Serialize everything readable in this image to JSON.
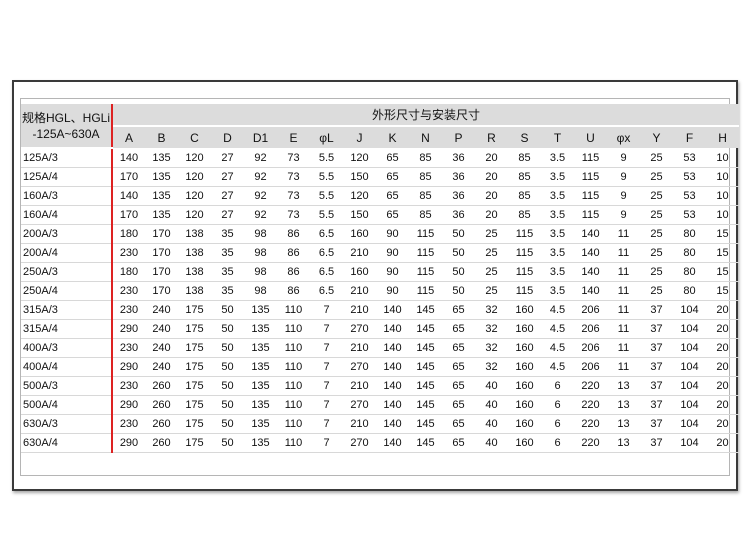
{
  "table": {
    "spec_header_line1": "规格HGL、HGLi",
    "spec_header_line2": "-125A~630A",
    "group_header": "外形尺寸与安装尺寸",
    "columns": [
      "A",
      "B",
      "C",
      "D",
      "D1",
      "E",
      "φL",
      "J",
      "K",
      "N",
      "P",
      "R",
      "S",
      "T",
      "U",
      "φx",
      "Y",
      "F",
      "H"
    ],
    "rows": [
      {
        "spec": "125A/3",
        "values": [
          "140",
          "135",
          "120",
          "27",
          "92",
          "73",
          "5.5",
          "120",
          "65",
          "85",
          "36",
          "20",
          "85",
          "3.5",
          "115",
          "9",
          "25",
          "53",
          "10"
        ]
      },
      {
        "spec": "125A/4",
        "values": [
          "170",
          "135",
          "120",
          "27",
          "92",
          "73",
          "5.5",
          "150",
          "65",
          "85",
          "36",
          "20",
          "85",
          "3.5",
          "115",
          "9",
          "25",
          "53",
          "10"
        ]
      },
      {
        "spec": "160A/3",
        "values": [
          "140",
          "135",
          "120",
          "27",
          "92",
          "73",
          "5.5",
          "120",
          "65",
          "85",
          "36",
          "20",
          "85",
          "3.5",
          "115",
          "9",
          "25",
          "53",
          "10"
        ]
      },
      {
        "spec": "160A/4",
        "values": [
          "170",
          "135",
          "120",
          "27",
          "92",
          "73",
          "5.5",
          "150",
          "65",
          "85",
          "36",
          "20",
          "85",
          "3.5",
          "115",
          "9",
          "25",
          "53",
          "10"
        ]
      },
      {
        "spec": "200A/3",
        "values": [
          "180",
          "170",
          "138",
          "35",
          "98",
          "86",
          "6.5",
          "160",
          "90",
          "115",
          "50",
          "25",
          "115",
          "3.5",
          "140",
          "11",
          "25",
          "80",
          "15"
        ]
      },
      {
        "spec": "200A/4",
        "values": [
          "230",
          "170",
          "138",
          "35",
          "98",
          "86",
          "6.5",
          "210",
          "90",
          "115",
          "50",
          "25",
          "115",
          "3.5",
          "140",
          "11",
          "25",
          "80",
          "15"
        ]
      },
      {
        "spec": "250A/3",
        "values": [
          "180",
          "170",
          "138",
          "35",
          "98",
          "86",
          "6.5",
          "160",
          "90",
          "115",
          "50",
          "25",
          "115",
          "3.5",
          "140",
          "11",
          "25",
          "80",
          "15"
        ]
      },
      {
        "spec": "250A/4",
        "values": [
          "230",
          "170",
          "138",
          "35",
          "98",
          "86",
          "6.5",
          "210",
          "90",
          "115",
          "50",
          "25",
          "115",
          "3.5",
          "140",
          "11",
          "25",
          "80",
          "15"
        ]
      },
      {
        "spec": "315A/3",
        "values": [
          "230",
          "240",
          "175",
          "50",
          "135",
          "110",
          "7",
          "210",
          "140",
          "145",
          "65",
          "32",
          "160",
          "4.5",
          "206",
          "11",
          "37",
          "104",
          "20"
        ]
      },
      {
        "spec": "315A/4",
        "values": [
          "290",
          "240",
          "175",
          "50",
          "135",
          "110",
          "7",
          "270",
          "140",
          "145",
          "65",
          "32",
          "160",
          "4.5",
          "206",
          "11",
          "37",
          "104",
          "20"
        ]
      },
      {
        "spec": "400A/3",
        "values": [
          "230",
          "240",
          "175",
          "50",
          "135",
          "110",
          "7",
          "210",
          "140",
          "145",
          "65",
          "32",
          "160",
          "4.5",
          "206",
          "11",
          "37",
          "104",
          "20"
        ]
      },
      {
        "spec": "400A/4",
        "values": [
          "290",
          "240",
          "175",
          "50",
          "135",
          "110",
          "7",
          "270",
          "140",
          "145",
          "65",
          "32",
          "160",
          "4.5",
          "206",
          "11",
          "37",
          "104",
          "20"
        ]
      },
      {
        "spec": "500A/3",
        "values": [
          "230",
          "260",
          "175",
          "50",
          "135",
          "110",
          "7",
          "210",
          "140",
          "145",
          "65",
          "40",
          "160",
          "6",
          "220",
          "13",
          "37",
          "104",
          "20"
        ]
      },
      {
        "spec": "500A/4",
        "values": [
          "290",
          "260",
          "175",
          "50",
          "135",
          "110",
          "7",
          "270",
          "140",
          "145",
          "65",
          "40",
          "160",
          "6",
          "220",
          "13",
          "37",
          "104",
          "20"
        ]
      },
      {
        "spec": "630A/3",
        "values": [
          "230",
          "260",
          "175",
          "50",
          "135",
          "110",
          "7",
          "210",
          "140",
          "145",
          "65",
          "40",
          "160",
          "6",
          "220",
          "13",
          "37",
          "104",
          "20"
        ]
      },
      {
        "spec": "630A/4",
        "values": [
          "290",
          "260",
          "175",
          "50",
          "135",
          "110",
          "7",
          "270",
          "140",
          "145",
          "65",
          "40",
          "160",
          "6",
          "220",
          "13",
          "37",
          "104",
          "20"
        ]
      }
    ]
  },
  "colors": {
    "header_bg": "#dcdcdc",
    "divider_red": "#dd2222"
  }
}
